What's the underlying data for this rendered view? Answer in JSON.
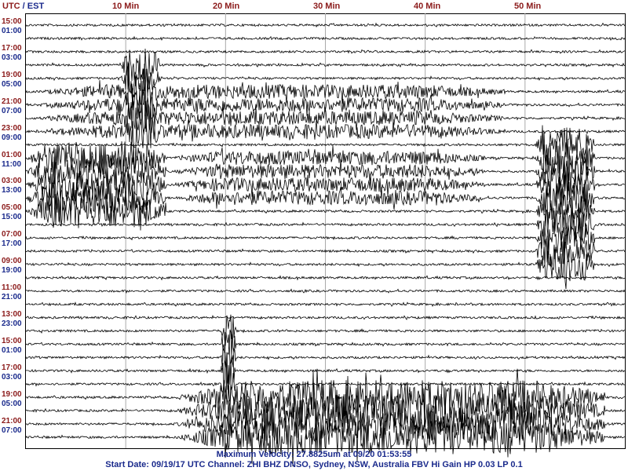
{
  "header": {
    "utc": "UTC",
    "sep": "/",
    "est": "EST"
  },
  "minute_labels": [
    "10 Min",
    "20 Min",
    "30 Min",
    "40 Min",
    "50 Min"
  ],
  "utc_labels": [
    "15:00",
    "17:00",
    "19:00",
    "21:00",
    "23:00",
    "01:00",
    "03:00",
    "05:00",
    "07:00",
    "09:00",
    "11:00",
    "13:00",
    "15:00",
    "17:00",
    "19:00",
    "21:00"
  ],
  "est_labels": [
    "01:00",
    "03:00",
    "05:00",
    "07:00",
    "09:00",
    "11:00",
    "13:00",
    "15:00",
    "17:00",
    "19:00",
    "21:00",
    "23:00",
    "01:00",
    "03:00",
    "05:00",
    "07:00"
  ],
  "footer": {
    "line1": "Maximum Velocity: 27.8825um at 09/20 01:53:55",
    "line2": "Start Date: 09/19/17 UTC Channel: ZHI  BHZ  DNSO, Sydney, NSW, Australia  FBV Hi Gain HP 0.03  LP 0.1"
  },
  "chart_data": {
    "type": "line",
    "title": "",
    "x_range_minutes": [
      0,
      60
    ],
    "x_ticks": [
      10,
      20,
      30,
      40,
      50
    ],
    "rows": 32,
    "trace_color": "#000000",
    "grid_color": "#aaaaaa",
    "utc_color": "#8b1a1a",
    "est_color": "#1a2a8c",
    "events": [
      {
        "rows": [
          3,
          8
        ],
        "start_min": 9.5,
        "end_min": 13.5,
        "amplitude": "large"
      },
      {
        "rows": [
          5,
          8
        ],
        "start_min": 0,
        "end_min": 48,
        "amplitude": "medium"
      },
      {
        "rows": [
          10,
          14
        ],
        "start_min": 0,
        "end_min": 14,
        "amplitude": "large"
      },
      {
        "rows": [
          10,
          13
        ],
        "start_min": 14,
        "end_min": 46,
        "amplitude": "medium"
      },
      {
        "rows": [
          9,
          18
        ],
        "start_min": 51,
        "end_min": 57,
        "amplitude": "large"
      },
      {
        "rows": [
          23,
          27
        ],
        "start_min": 19.5,
        "end_min": 21,
        "amplitude": "large"
      },
      {
        "rows": [
          28,
          31
        ],
        "start_min": 14.5,
        "end_min": 58,
        "amplitude": "large"
      }
    ]
  }
}
